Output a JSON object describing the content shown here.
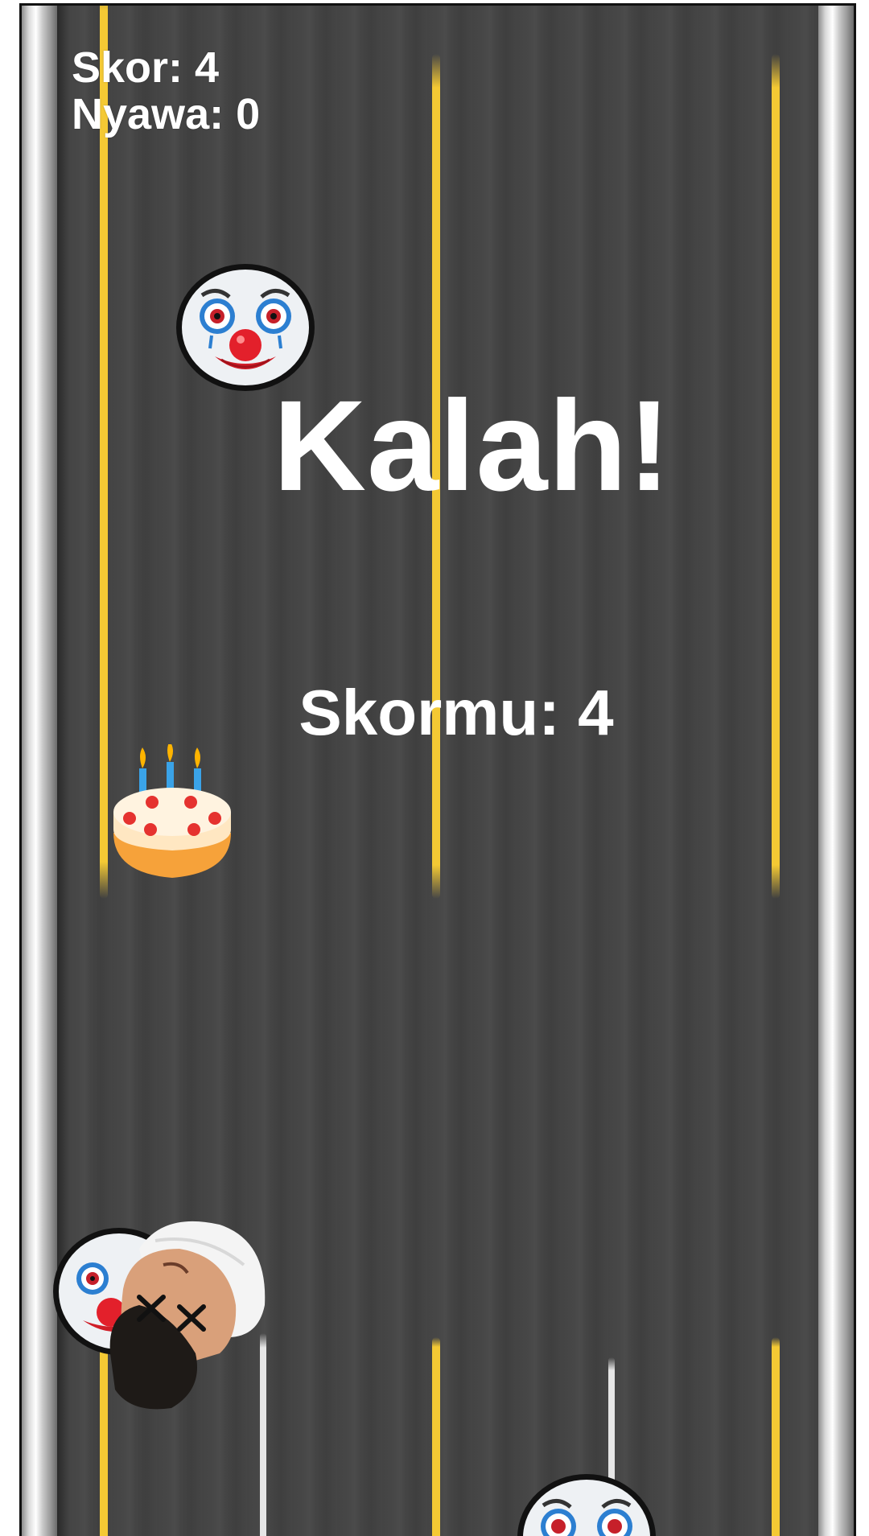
{
  "hud": {
    "score_label": "Skor: 4",
    "lives_label": "Nyawa: 0"
  },
  "game_over": {
    "title": "Kalah!",
    "final_score": "Skormu: 4"
  },
  "sprites": {
    "enemy": "clown-face-icon",
    "bonus": "birthday-cake-icon",
    "player": "player-face-dead-icon"
  },
  "colors": {
    "road": "#444444",
    "lane_yellow": "#f4c934",
    "lane_white": "#e6e6e6",
    "text": "#ffffff"
  }
}
